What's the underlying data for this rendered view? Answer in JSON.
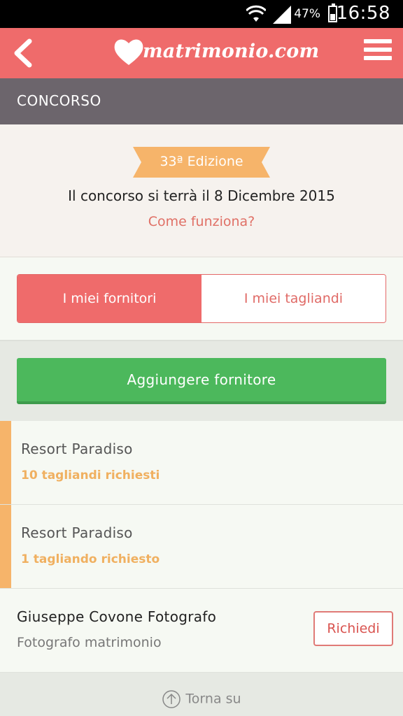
{
  "status": {
    "battery_pct": "47%",
    "time": "16:58",
    "battery_level": 0.47
  },
  "appbar": {
    "brand": "matrimonio.com"
  },
  "section": {
    "title": "CONCORSO"
  },
  "hero": {
    "edition": "33ª Edizione",
    "date_text": "Il concorso si terrà il 8 Dicembre 2015",
    "how_link": "Come funziona?"
  },
  "tabs": [
    {
      "label": "I miei fornitori",
      "active": true
    },
    {
      "label": "I miei tagliandi",
      "active": false
    }
  ],
  "add_button": "Aggiungere fornitore",
  "vendors": [
    {
      "name": "Resort Paradiso",
      "detail": "10 tagliandi richiesti"
    },
    {
      "name": "Resort Paradiso",
      "detail": "1 tagliando richiesto"
    },
    {
      "name": "Giuseppe Covone Fotografo",
      "detail": "Fotografo matrimonio",
      "action": "Richiedi"
    }
  ],
  "back_to_top": "Torna su",
  "colors": {
    "brand": "#ef6b6b",
    "section": "#6c656c",
    "success": "#4cb85c",
    "accent_orange": "#f6b46a"
  }
}
